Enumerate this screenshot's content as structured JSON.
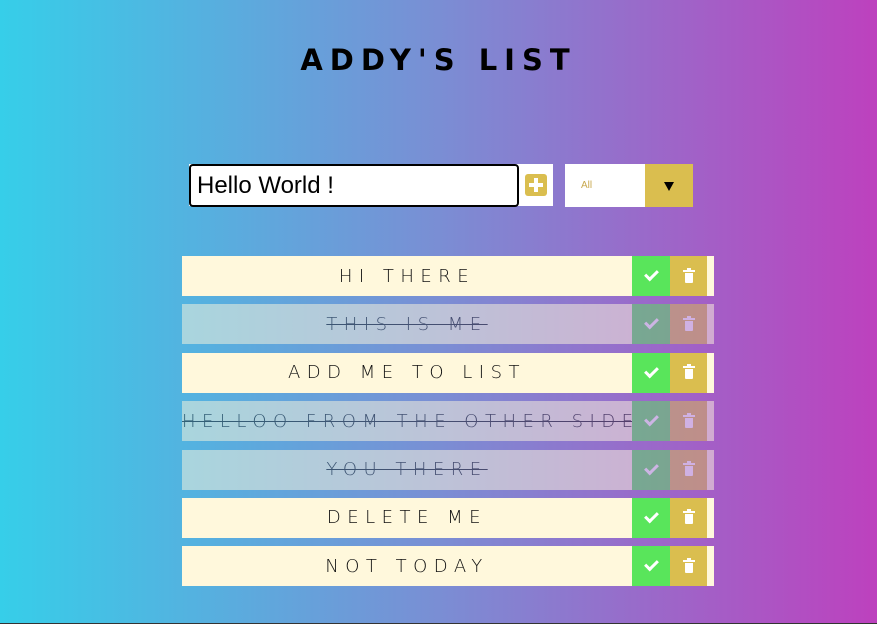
{
  "header": {
    "title": "ADDY'S LIST"
  },
  "input": {
    "value": "Hello World !"
  },
  "filter": {
    "selected": "All"
  },
  "todos": [
    {
      "text": "HI THERE",
      "completed": false
    },
    {
      "text": "THIS IS ME",
      "completed": true
    },
    {
      "text": "ADD ME TO LIST",
      "completed": false
    },
    {
      "text": "HELLOO FROM THE OTHER SIDE",
      "completed": true
    },
    {
      "text": "YOU THERE",
      "completed": true
    },
    {
      "text": "DELETE ME",
      "completed": false
    },
    {
      "text": "NOT TODAY",
      "completed": false
    }
  ],
  "icons": {
    "add": "plus-square-icon",
    "dropdown": "caret-down-icon",
    "complete": "check-icon",
    "delete": "trash-icon"
  },
  "colors": {
    "accent": "#dabe4f",
    "check": "#59e55b",
    "item_bg": "#fff8dc"
  }
}
